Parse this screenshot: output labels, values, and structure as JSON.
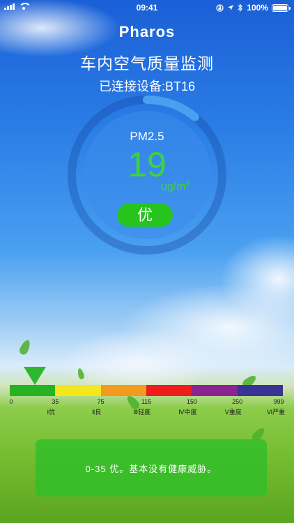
{
  "status_bar": {
    "time": "09:41",
    "battery": "100%",
    "icons": [
      "signal-icon",
      "wifi-icon",
      "lock-rotation-icon",
      "location-icon",
      "bluetooth-icon",
      "battery-icon"
    ]
  },
  "header": {
    "brand": "Pharos",
    "title": "车内空气质量监测",
    "connection": "已连接设备:BT16"
  },
  "gauge": {
    "label": "PM2.5",
    "value": "19",
    "unit": "ug/m",
    "unit_sup": "3",
    "level_label": "优",
    "progress_fraction": 0.11,
    "value_color": "#3fd23f"
  },
  "scale": {
    "segment_colors": [
      "#27b321",
      "#f5e61e",
      "#f29b1e",
      "#f01c1c",
      "#8b2490",
      "#3a3396"
    ],
    "ticks": [
      "0",
      "35",
      "75",
      "115",
      "150",
      "250",
      "999"
    ],
    "grades": [
      "Ⅰ优",
      "Ⅱ良",
      "Ⅲ轻度",
      "Ⅳ中度",
      "Ⅴ重度",
      "Ⅵ严重"
    ]
  },
  "info": {
    "text": "0-35    优。基本没有健康威胁。"
  }
}
